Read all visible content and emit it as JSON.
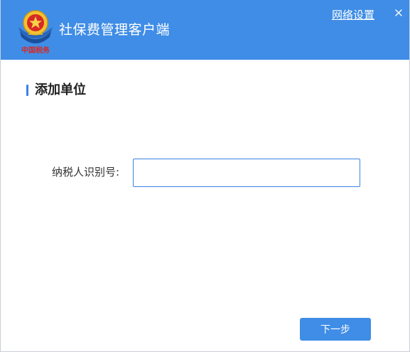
{
  "titlebar": {
    "app_title": "社保费管理客户端",
    "network_settings_link": "网络设置",
    "logo_text": "中国税务",
    "background_color": "#3f8de6"
  },
  "section": {
    "title": "添加单位"
  },
  "form": {
    "taxpayer_id_label": "纳税人识别号:",
    "taxpayer_id_value": "",
    "taxpayer_id_placeholder": ""
  },
  "footer": {
    "next_button_label": "下一步"
  },
  "icons": {
    "logo": "tax-emblem-icon",
    "close": "close-icon"
  },
  "colors": {
    "accent": "#3b82e4",
    "title_bar": "#3f8de6",
    "text": "#333333"
  }
}
